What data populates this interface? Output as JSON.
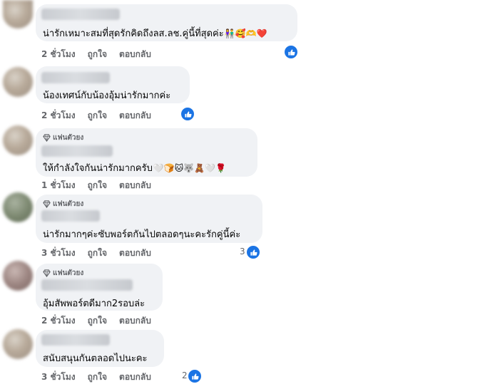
{
  "comments": [
    {
      "text": "น่ารักเหมาะสมที่สุดรักคิดถึงลส.ลช.คู่นี้ที่สุดค่ะ",
      "emojis": "👫🥰🫶❤️",
      "fan_badge": "",
      "time": "2 ชั่วโมง",
      "like": "ถูกใจ",
      "reply": "ตอบกลับ",
      "reaction_count": ""
    },
    {
      "text": "น้องเทศน์กับน้องอุ้มน่ารักมากค่ะ",
      "emojis": "",
      "fan_badge": "",
      "time": "2 ชั่วโมง",
      "like": "ถูกใจ",
      "reply": "ตอบกลับ",
      "reaction_count": ""
    },
    {
      "text": "ให้กำลังใจกันน่ารักมากครับ",
      "emojis": "🤍🍞🐱🐺🧸🤍🌹",
      "fan_badge": "แฟนตัวยง",
      "time": "1 ชั่วโมง",
      "like": "ถูกใจ",
      "reply": "ตอบกลับ",
      "reaction_count": ""
    },
    {
      "text": "น่ารักมากๆค่ะซับพอร์ตกันไปตลอดๆนะคะรักคู่นี้ค่ะ",
      "emojis": "",
      "fan_badge": "แฟนตัวยง",
      "time": "3 ชั่วโมง",
      "like": "ถูกใจ",
      "reply": "ตอบกลับ",
      "reaction_count": "3"
    },
    {
      "text": "อุ้มสัพพอร์ตดีมาก2รอบล่ะ",
      "emojis": "",
      "fan_badge": "แฟนตัวยง",
      "time": "2 ชั่วโมง",
      "like": "ถูกใจ",
      "reply": "ตอบกลับ",
      "reaction_count": ""
    },
    {
      "text": "สนับสนุนกันตลอดไปนะคะ",
      "emojis": "",
      "fan_badge": "",
      "time": "3 ชั่วโมง",
      "like": "ถูกใจ",
      "reply": "ตอบกลับ",
      "reaction_count": "2"
    }
  ],
  "colors": {
    "bubble": "#f0f2f5",
    "meta": "#65676b",
    "like_blue": "#1b74e4"
  },
  "icons": {
    "badge": "diamond-icon",
    "reaction": "thumbs-up-icon"
  }
}
